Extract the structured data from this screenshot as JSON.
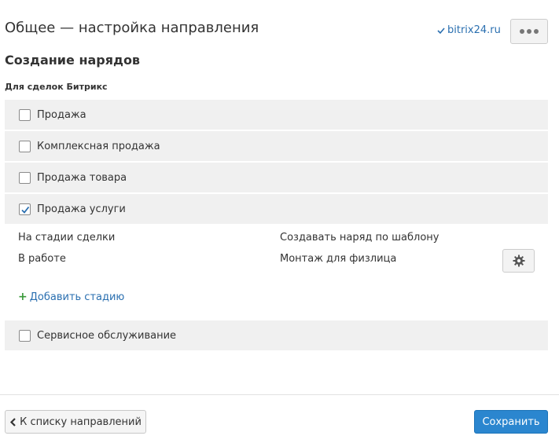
{
  "header": {
    "title": "Общее — настройка направления",
    "site_link": "bitrix24.ru",
    "site_link_icon": "check-icon",
    "more_icon": "more-icon"
  },
  "section": {
    "title": "Создание нарядов",
    "group_label": "Для сделок Битрикс"
  },
  "options": [
    {
      "label": "Продажа",
      "checked": false
    },
    {
      "label": "Комплексная продажа",
      "checked": false
    },
    {
      "label": "Продажа товара",
      "checked": false
    },
    {
      "label": "Продажа услуги",
      "checked": true
    },
    {
      "label": "Сервисное обслуживание",
      "checked": false
    }
  ],
  "stage_table": {
    "headers": [
      "На стадии сделки",
      "Создавать наряд по шаблону"
    ],
    "rows": [
      {
        "stage": "В работе",
        "template": "Монтаж для физлица"
      }
    ],
    "settings_icon": "gear-icon",
    "add_stage_label": "Добавить стадию"
  },
  "footer": {
    "back_label": "К списку направлений",
    "save_label": "Сохранить"
  },
  "colors": {
    "accent": "#2b86cf",
    "link": "#2a6fb0",
    "row_bg": "#f0f0f0",
    "plus": "#3a9a3a"
  }
}
